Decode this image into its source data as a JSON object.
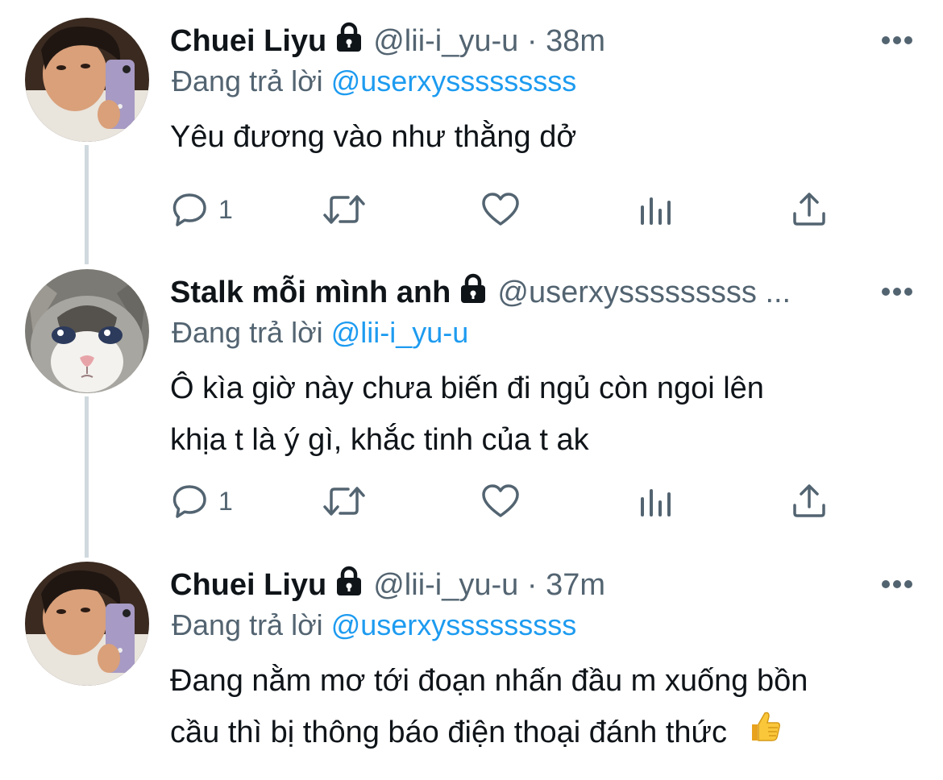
{
  "colors": {
    "text_primary": "#0f1419",
    "text_secondary": "#536471",
    "link": "#1d9bf0",
    "thread_line": "#cfd9de"
  },
  "tweets": [
    {
      "display_name": "Chuei Liyu",
      "handle": "@lii-i_yu-u",
      "separator": "·",
      "time": "38m",
      "replying_prefix": "Đang trả lời",
      "replying_to": "@userxysssssssss",
      "text": "Yêu đương vào như thằng dở",
      "text_line2": "",
      "reply_count": "1",
      "avatar": "selfie-avatar-icon"
    },
    {
      "display_name": "Stalk mỗi mình anh",
      "handle": "@userxysssssssss ...",
      "separator": "",
      "time": "",
      "replying_prefix": "Đang trả lời",
      "replying_to": "@lii-i_yu-u",
      "text": "Ô kìa giờ này chưa biến đi ngủ còn ngoi lên",
      "text_line2": "khịa t là ý gì, khắc tinh của t ak",
      "reply_count": "1",
      "avatar": "cat-avatar-icon"
    },
    {
      "display_name": "Chuei Liyu",
      "handle": "@lii-i_yu-u",
      "separator": "·",
      "time": "37m",
      "replying_prefix": "Đang trả lời",
      "replying_to": "@userxysssssssss",
      "text": "Đang nằm mơ tới đoạn nhấn đầu m xuống bồn",
      "text_line2": "cầu thì bị thông báo điện thoại đánh thức",
      "reply_count": "",
      "avatar": "selfie-avatar-icon",
      "emoji": "thumbs-up-icon"
    }
  ]
}
